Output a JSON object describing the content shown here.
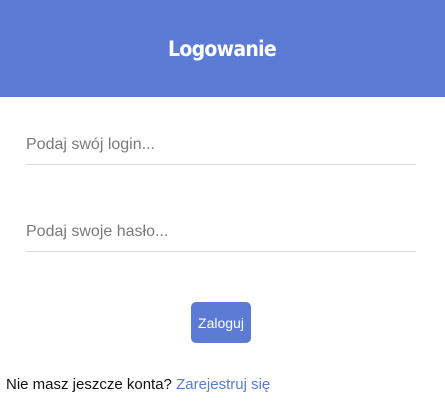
{
  "header": {
    "title": "Logowanie"
  },
  "form": {
    "login": {
      "placeholder": "Podaj swój login...",
      "value": ""
    },
    "password": {
      "placeholder": "Podaj swoje hasło...",
      "value": ""
    },
    "submit_label": "Zaloguj"
  },
  "footer": {
    "prompt_text": "Nie masz jeszcze konta?",
    "register_link_label": "Zarejestruj się"
  },
  "colors": {
    "accent": "#5b7bd5",
    "input_border": "#dcdcdc",
    "placeholder": "#7a7a7a"
  }
}
